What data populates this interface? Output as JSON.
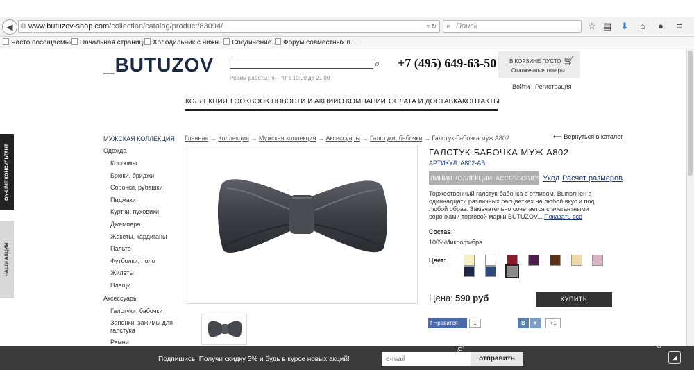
{
  "browser": {
    "url_domain": "www.butuzov-shop.com",
    "url_path": "/collection/catalog/product/83094/",
    "search_placeholder": "Поиск",
    "bookmarks": [
      "Часто посещаемые",
      "Начальная страница",
      "Холодильник с нижн...",
      "Соединение...",
      "Форум совместных п..."
    ]
  },
  "header": {
    "logo": "_BUTUZOV",
    "work_hours": "Режим работы: пн - пт с 10:00 до 21:00",
    "phone": "+7 (495) 649-63-50",
    "cart_empty": "В КОРЗИНЕ ПУСТО",
    "cart_deferred": "Отложенные товары",
    "login": "Войти",
    "auth_sep": "/",
    "register": "Регистрация"
  },
  "nav": [
    "КОЛЛЕКЦИЯ",
    "LOOKBOOK",
    "НОВОСТИ И АКЦИИ",
    "О КОМПАНИИ",
    "ОПЛАТА И ДОСТАВКА",
    "КОНТАКТЫ"
  ],
  "side_tabs": {
    "consultant": "ON-LINE КОНСУЛЬТАНТ",
    "promo": "НАШИ АКЦИИ"
  },
  "catalog": {
    "title": "МУЖСКАЯ КОЛЛЕКЦИЯ",
    "group1": "Одежда",
    "clothes": [
      "Костюмы",
      "Брюки, бриджи",
      "Сорочки, рубашки",
      "Пиджаки",
      "Куртки, пуховики",
      "Джемпера",
      "Жакеты, кардиганы",
      "Пальто",
      "Футболки, поло",
      "Жилеты",
      "Плащи"
    ],
    "group2": "Аксессуары",
    "accessories": [
      "Галстуки, бабочки",
      "Запонки, зажимы для галстука",
      "Ремни"
    ]
  },
  "breadcrumb": {
    "items": [
      "Главная",
      "Коллекция",
      "Мужская коллекция",
      "Аксессуары",
      "Галстуки, бабочки"
    ],
    "arrow": "→",
    "current": "Галстук-бабочка муж A802",
    "back": "Вернуться в каталог",
    "back_arrow": "⟵"
  },
  "product": {
    "title": "ГАЛСТУК-БАБОЧКА МУЖ A802",
    "sku": "АРТИКУЛ: A802-AB",
    "line_badge": "ЛИНИЯ КОЛЛЕКЦИИ: ACCESSORIES",
    "care": "Уход",
    "size_calc": "Расчет размеров",
    "description": "Торжественный галстук-бабочка с отливом. Выполнен в одиннадцати различных расцветках на любой вкус и под любой образ. Замечательно сочетается с элегантными сорочками торговой марки BUTUZOV...",
    "show_all": "Показать все",
    "composition_label": "Состав:",
    "composition_value": "100%Микрофибра",
    "color_label": "Цвет:",
    "swatches": [
      "#f7efc2",
      "#ffffff",
      "#8a1a2c",
      "#4a1f4d",
      "#5a3318",
      "#efd9a6",
      "#d9b3c3",
      "#1c2747",
      "#2d4a7a",
      "#8a8a8a"
    ],
    "price_label": "Цена:",
    "price_value": "590 руб",
    "buy": "КУПИТЬ"
  },
  "social": {
    "fb_like": "Нравится",
    "fb_count": "1",
    "vk": "В",
    "vk_heart": "♥",
    "vk_count": "+1"
  },
  "subscribe": {
    "text": "Подпишись! Получи скидку 5% и будь в курсе новых акций!",
    "placeholder": "e-mail",
    "send": "отправить"
  },
  "watermark": {
    "w1": "ovo.ru",
    "w2": "ovo.ru"
  }
}
